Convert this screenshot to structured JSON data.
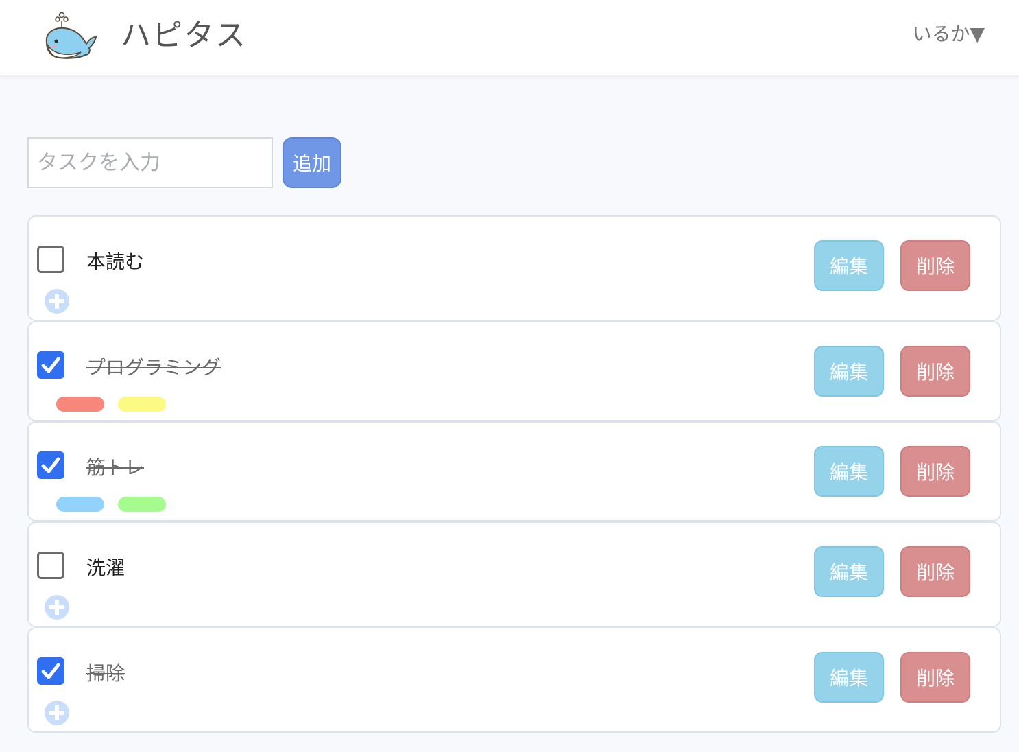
{
  "header": {
    "app_title": "ハピタス",
    "user_menu": "いるか▼"
  },
  "new_task": {
    "placeholder": "タスクを入力",
    "value": "",
    "add_label": "追加"
  },
  "tasks": [
    {
      "title": "本読む",
      "done": false,
      "tags": []
    },
    {
      "title": "プログラミング",
      "done": true,
      "tags": [
        "#f7877a",
        "#fbfb84"
      ]
    },
    {
      "title": "筋トレ",
      "done": true,
      "tags": [
        "#93d3fb",
        "#a6fb8e"
      ]
    },
    {
      "title": "洗濯",
      "done": false,
      "tags": []
    },
    {
      "title": "掃除",
      "done": true,
      "tags": []
    }
  ],
  "actions": {
    "edit_label": "編集",
    "delete_label": "削除"
  },
  "colors": {
    "accent": "#7096e6",
    "checkbox_checked": "#2f6ff0",
    "edit": "#95d3ea",
    "delete": "#d98f8f"
  },
  "icons": {
    "logo": "whale-logo-icon",
    "add_tag": "plus-circle-icon",
    "checked": "checkmark-icon"
  }
}
